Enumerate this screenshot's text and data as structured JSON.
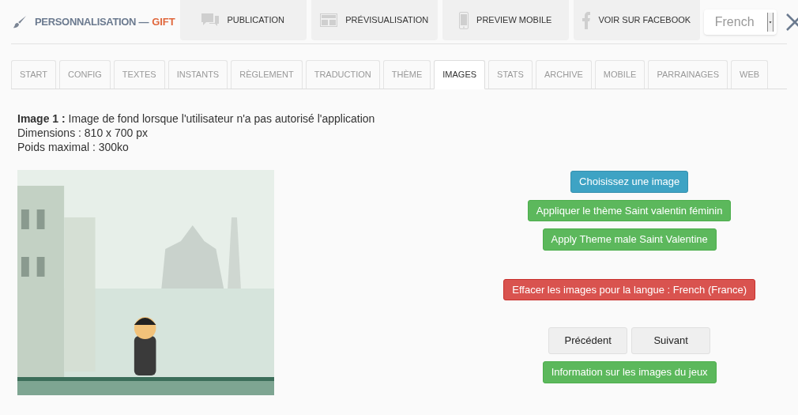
{
  "header": {
    "title": "PERSONNALISATION —",
    "title_accent": "GIFT",
    "actions": [
      {
        "label": "PUBLICATION"
      },
      {
        "label": "PRÉVISUALISATION"
      },
      {
        "label": "PREVIEW MOBILE"
      },
      {
        "label": "VOIR SUR FACEBOOK"
      }
    ],
    "language": "French"
  },
  "tabs": [
    {
      "label": "START",
      "selected": false
    },
    {
      "label": "CONFIG",
      "selected": false
    },
    {
      "label": "TEXTES",
      "selected": false
    },
    {
      "label": "INSTANTS",
      "selected": false
    },
    {
      "label": "RÈGLEMENT",
      "selected": false
    },
    {
      "label": "TRADUCTION",
      "selected": false
    },
    {
      "label": "THÈME",
      "selected": false
    },
    {
      "label": "IMAGES",
      "selected": true
    },
    {
      "label": "STATS",
      "selected": false
    },
    {
      "label": "ARCHIVE",
      "selected": false
    },
    {
      "label": "MOBILE",
      "selected": false
    },
    {
      "label": "PARRAINAGES",
      "selected": false
    },
    {
      "label": "WEB",
      "selected": false
    }
  ],
  "image_info": {
    "description": "**Image 1 :** Image de fond lorsque l'utilisateur n'a pas autorisé l'application",
    "dimensions": "Dimensions : 810 x 700 px",
    "max_weight": "Poids maximal : 300ko"
  },
  "preview": {
    "kind": "picture"
  },
  "button_groups": [
    [
      {
        "label": "Choisissez une image",
        "kind": "info"
      }
    ],
    [
      {
        "label": "Appliquer le thème Saint valentin féminin",
        "kind": "success"
      }
    ],
    [
      {
        "label": "Apply Theme male Saint Valentine",
        "kind": "success"
      }
    ],
    [
      {
        "label": "Effacer les images pour la langue : French (France)",
        "kind": "danger"
      }
    ],
    [
      {
        "label": "Précédent",
        "kind": "default"
      },
      {
        "label": "Suivant",
        "kind": "default"
      }
    ],
    [
      {
        "label": "Information sur les images du jeux",
        "kind": "success"
      }
    ]
  ]
}
